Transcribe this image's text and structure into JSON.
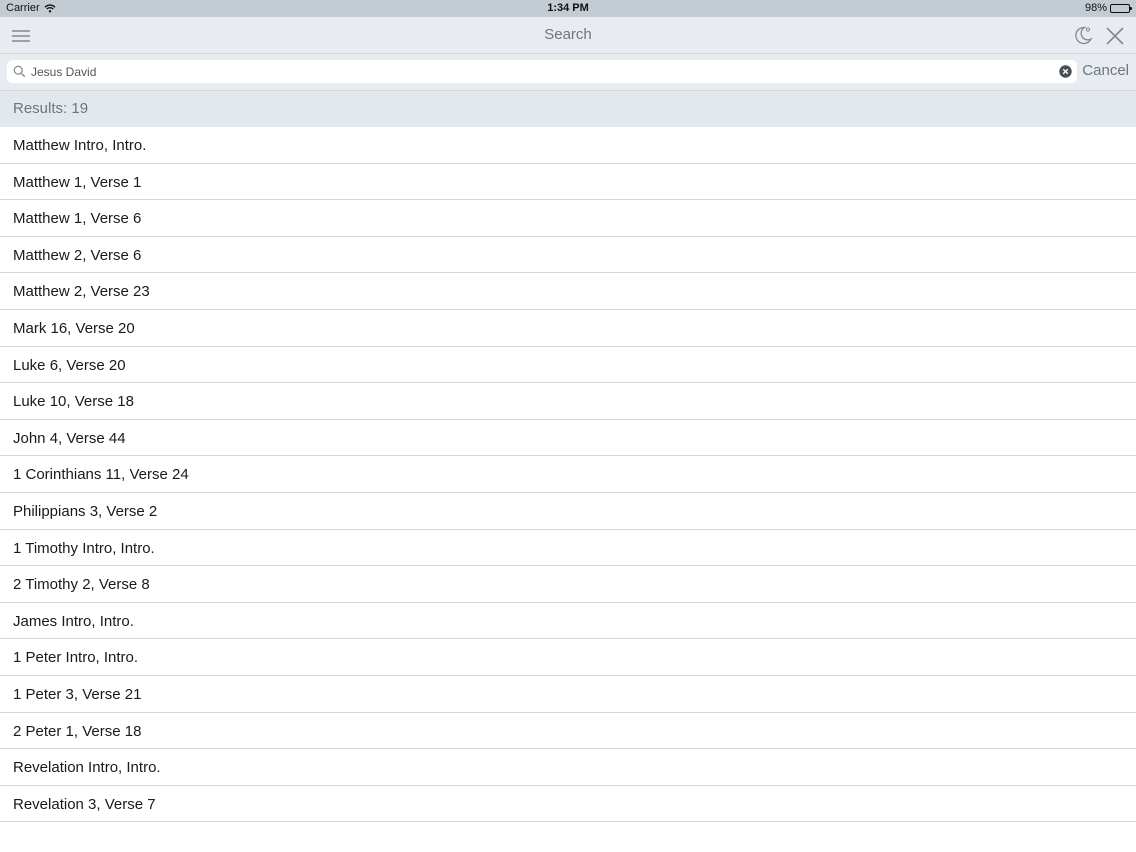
{
  "status_bar": {
    "carrier": "Carrier",
    "time": "1:34 PM",
    "battery": "98%"
  },
  "nav_bar": {
    "title": "Search",
    "icons": [
      "menu-icon",
      "night-mode-icon",
      "close-icon"
    ]
  },
  "search": {
    "value": "Jesus David",
    "cancel_label": "Cancel"
  },
  "results": {
    "header": "Results: 19",
    "items": [
      "Matthew Intro, Intro.",
      "Matthew 1, Verse 1",
      "Matthew 1, Verse 6",
      "Matthew 2, Verse 6",
      "Matthew 2, Verse 23",
      "Mark 16, Verse 20",
      "Luke 6, Verse 20",
      "Luke 10, Verse 18",
      "John 4, Verse 44",
      "1 Corinthians 11, Verse 24",
      "Philippians 3, Verse 2",
      "1 Timothy Intro, Intro.",
      "2 Timothy 2, Verse 8",
      "James Intro, Intro.",
      "1 Peter Intro, Intro.",
      "1 Peter 3, Verse 21",
      "2 Peter 1, Verse 18",
      "Revelation Intro, Intro.",
      "Revelation 3, Verse 7"
    ]
  },
  "colors": {
    "status_bar_bg": "#c3ccd3",
    "nav_bg": "#e8ecf0",
    "header_bg": "#e3e8ed",
    "accent_text": "#6b7680"
  }
}
